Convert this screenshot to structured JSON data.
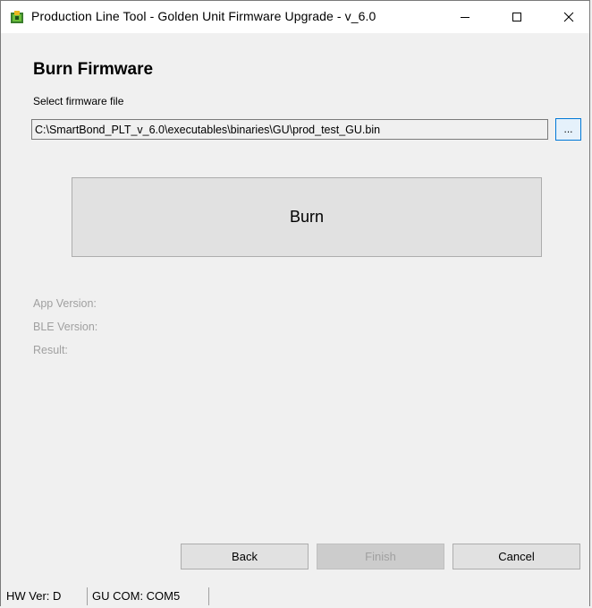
{
  "window": {
    "title": "Production Line Tool - Golden Unit Firmware Upgrade - v_6.0",
    "icon": "app-icon"
  },
  "page": {
    "heading": "Burn Firmware",
    "select_label": "Select firmware file",
    "file_path": "C:\\SmartBond_PLT_v_6.0\\executables\\binaries\\GU\\prod_test_GU.bin",
    "browse_label": "...",
    "burn_label": "Burn",
    "app_version_label": "App Version:",
    "ble_version_label": "BLE Version:",
    "result_label": "Result:"
  },
  "buttons": {
    "back": "Back",
    "finish": "Finish",
    "cancel": "Cancel"
  },
  "status": {
    "hw_ver": "HW Ver:  D",
    "gu_com": "GU COM:  COM5"
  },
  "colors": {
    "disabled_text": "#a0a0a0",
    "focus_border": "#0078d7"
  }
}
